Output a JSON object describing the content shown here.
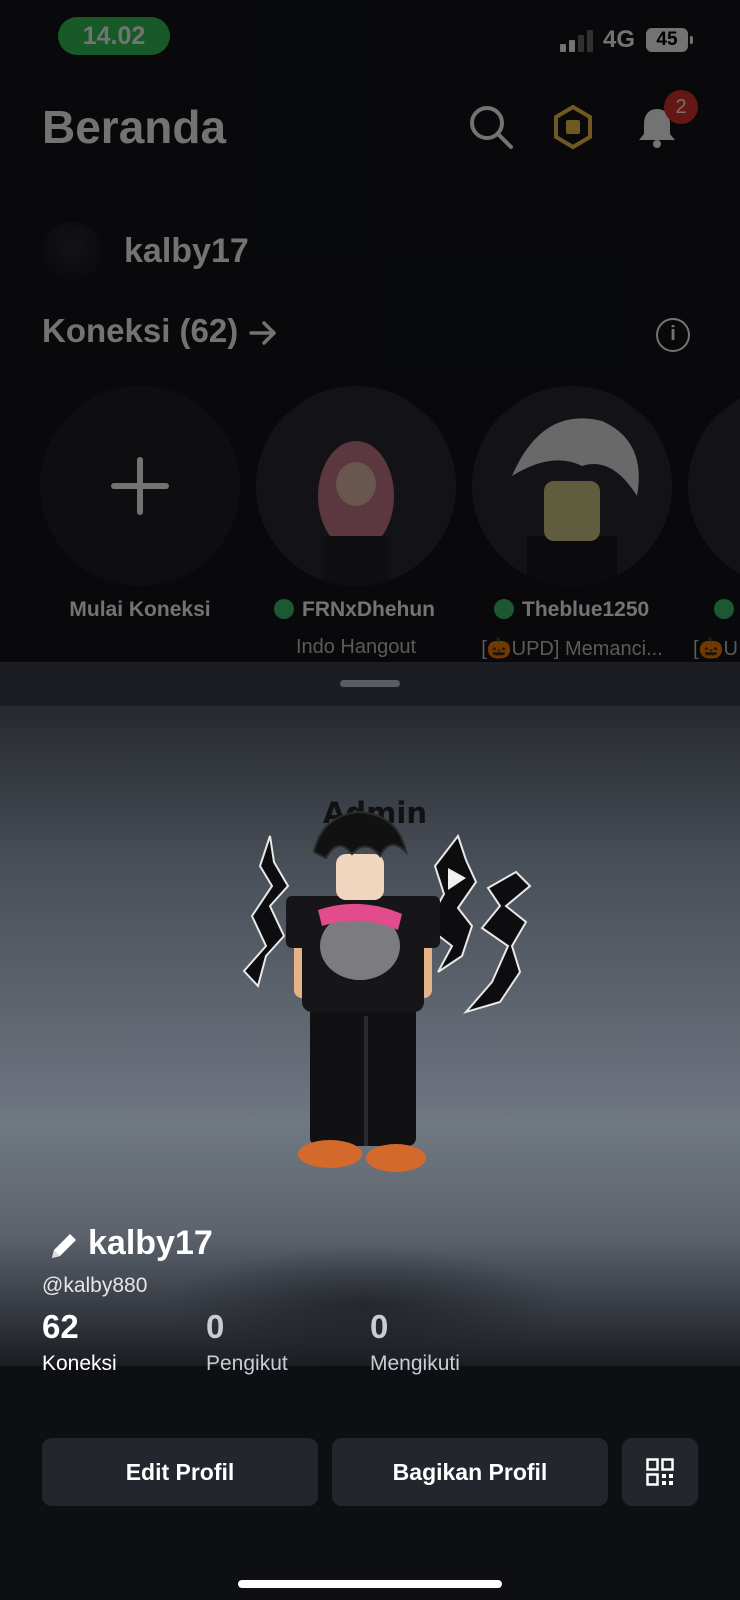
{
  "status_bar": {
    "time": "14.02",
    "network": "4G",
    "battery": "45"
  },
  "home": {
    "title": "Beranda",
    "notification_count": "2",
    "username": "kalby17",
    "connections_title": "Koneksi (62)",
    "friends": [
      {
        "name": "Mulai Koneksi",
        "sub": "",
        "online": false
      },
      {
        "name": "FRNxDhehun",
        "sub": "Indo Hangout",
        "online": true
      },
      {
        "name": "Theblue1250",
        "sub": "[🎃UPD] Memanci...",
        "online": true
      },
      {
        "name": "",
        "sub": "[🎃U",
        "online": true
      }
    ]
  },
  "profile": {
    "avatar_tag": "Admin",
    "display_name": "kalby17",
    "username": "@kalby880",
    "stats": [
      {
        "value": "62",
        "label": "Koneksi"
      },
      {
        "value": "0",
        "label": "Pengikut"
      },
      {
        "value": "0",
        "label": "Mengikuti"
      }
    ],
    "edit_button": "Edit Profil",
    "share_button": "Bagikan Profil"
  },
  "colors": {
    "online": "#3fc46f",
    "badge": "#e1342c",
    "time_pill": "#34c759",
    "button_bg": "#24262d"
  },
  "icons": [
    "search-icon",
    "robux-icon",
    "bell-icon",
    "arrow-right-icon",
    "info-icon",
    "plus-icon",
    "pencil-icon",
    "qr-code-icon"
  ]
}
